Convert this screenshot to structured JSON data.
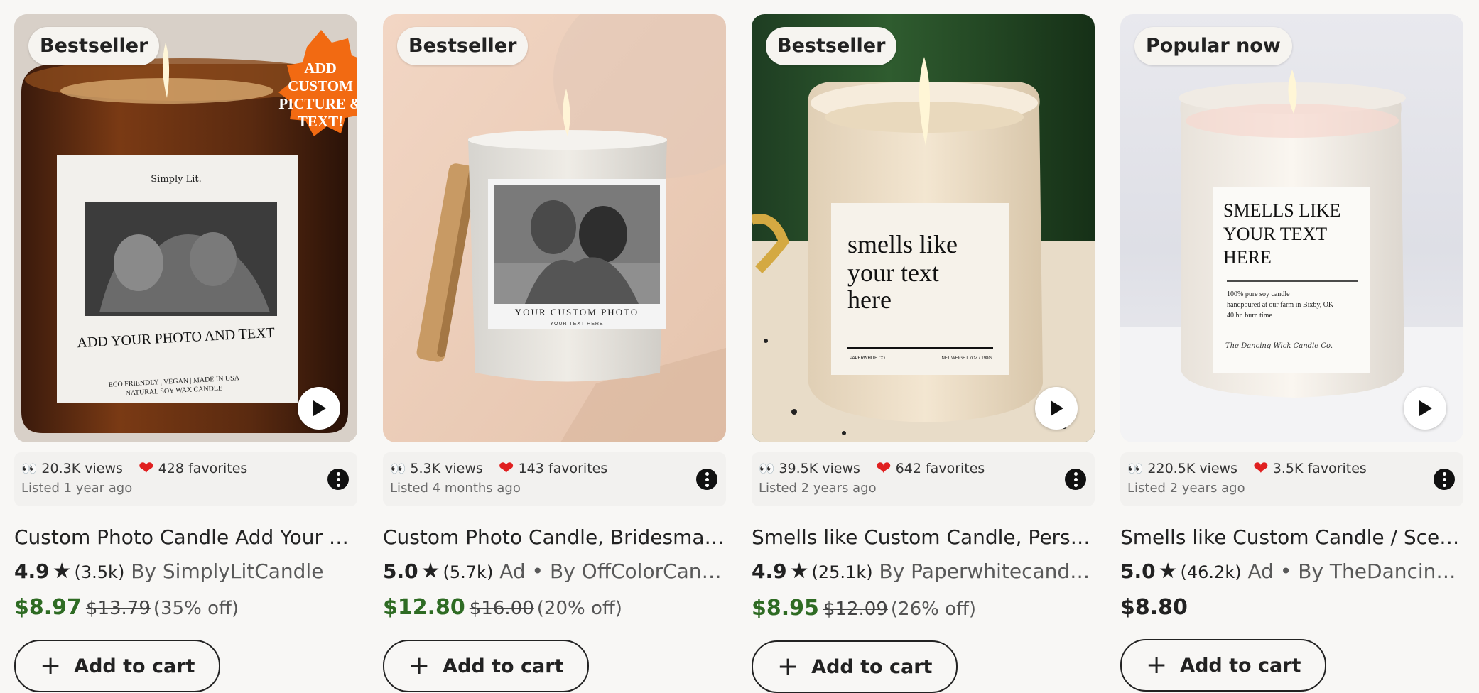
{
  "products": [
    {
      "badge": "Bestseller",
      "image": "amber-candle-photo",
      "views": "20.3K views",
      "favorites": "428 favorites",
      "listed": "Listed 1 year ago",
      "title": "Custom Photo Candle Add Your Picture and Text",
      "score": "4.9",
      "reviews": "(3.5k)",
      "ad": "",
      "seller": "By SimplyLitCandle",
      "price": "$8.97",
      "original_price": "$13.79",
      "discount": "(35% off)",
      "has_video": true,
      "label_text": "ADD YOUR PHOTO AND TEXT",
      "brand_text": "Simply Lit.",
      "footer_text": "ECO FRIENDLY | VEGAN | MADE IN USA",
      "footer_text2": "NATURAL SOY WAX CANDLE",
      "burst_text": [
        "ADD",
        "CUSTOM",
        "PICTURE &",
        "TEXT!"
      ]
    },
    {
      "badge": "Bestseller",
      "image": "frosted-candle-photo",
      "views": "5.3K views",
      "favorites": "143 favorites",
      "listed": "Listed 4 months ago",
      "title": "Custom Photo Candle, Bridesmaid Proposal Gift",
      "score": "5.0",
      "reviews": "(5.7k)",
      "ad": "Ad •",
      "seller": "By OffColorCandlesCo",
      "price": "$12.80",
      "original_price": "$16.00",
      "discount": "(20% off)",
      "has_video": false,
      "label_text": "YOUR CUSTOM PHOTO",
      "label_sub": "YOUR TEXT HERE"
    },
    {
      "badge": "Bestseller",
      "image": "clear-jar-candle",
      "views": "39.5K views",
      "favorites": "642 favorites",
      "listed": "Listed 2 years ago",
      "title": "Smells like Custom Candle, Personalized Gift",
      "score": "4.9",
      "reviews": "(25.1k)",
      "ad": "",
      "seller": "By Paperwhitecandles",
      "star_seller": true,
      "price": "$8.95",
      "original_price": "$12.09",
      "discount": "(26% off)",
      "has_video": true,
      "label_lines": [
        "smells like",
        "your text",
        "here"
      ],
      "label_left": "PAPERWHITE CO.",
      "label_right": "NET WEIGHT 7OZ / 198G"
    },
    {
      "badge": "Popular now",
      "image": "white-jar-candle",
      "views": "220.5K views",
      "favorites": "3.5K favorites",
      "listed": "Listed 2 years ago",
      "title": "Smells like Custom Candle / Scented Soy Candle",
      "score": "5.0",
      "reviews": "(46.2k)",
      "ad": "Ad •",
      "seller": "By TheDancingWickCandleCo",
      "price": "$8.80",
      "original_price": "",
      "discount": "",
      "has_video": true,
      "label_lines": [
        "SMELLS LIKE",
        "YOUR TEXT",
        "HERE"
      ],
      "label_small": [
        "100% pure soy candle",
        "handpoured at our farm  in Bixby, OK",
        "40 hr. burn time"
      ],
      "label_sign": "The Dancing Wick Candle Co."
    }
  ],
  "ui": {
    "add_to_cart": "Add to cart",
    "eyes_icon": "👀",
    "heart_icon": "❤",
    "star_icon": "★",
    "colors": {
      "sale": "#2e6b23",
      "heart": "#e02020",
      "star_seller": "#a36bc7"
    }
  }
}
